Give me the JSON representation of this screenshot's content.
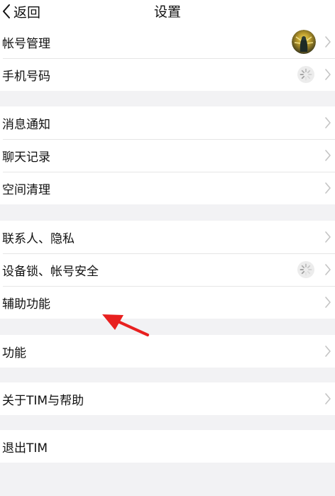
{
  "header": {
    "back_label": "返回",
    "title": "设置"
  },
  "groups": [
    {
      "items": [
        {
          "label": "帐号管理"
        },
        {
          "label": "手机号码"
        }
      ]
    },
    {
      "items": [
        {
          "label": "消息通知"
        },
        {
          "label": "聊天记录"
        },
        {
          "label": "空间清理"
        }
      ]
    },
    {
      "items": [
        {
          "label": "联系人、隐私"
        },
        {
          "label": "设备锁、帐号安全"
        },
        {
          "label": "辅助功能"
        }
      ]
    },
    {
      "items": [
        {
          "label": "功能"
        }
      ]
    },
    {
      "items": [
        {
          "label": "关于TIM与帮助"
        }
      ]
    },
    {
      "items": [
        {
          "label": "退出TIM"
        }
      ]
    }
  ],
  "colors": {
    "background": "#f2f2f4",
    "row_background": "#ffffff",
    "separator": "#e6e6e6",
    "chevron": "#c4c4c4",
    "annotation_arrow": "#e8201f"
  },
  "icons": {
    "back": "chevron-left-icon",
    "row_indicator": "chevron-right-icon",
    "loading": "spinner-icon"
  }
}
